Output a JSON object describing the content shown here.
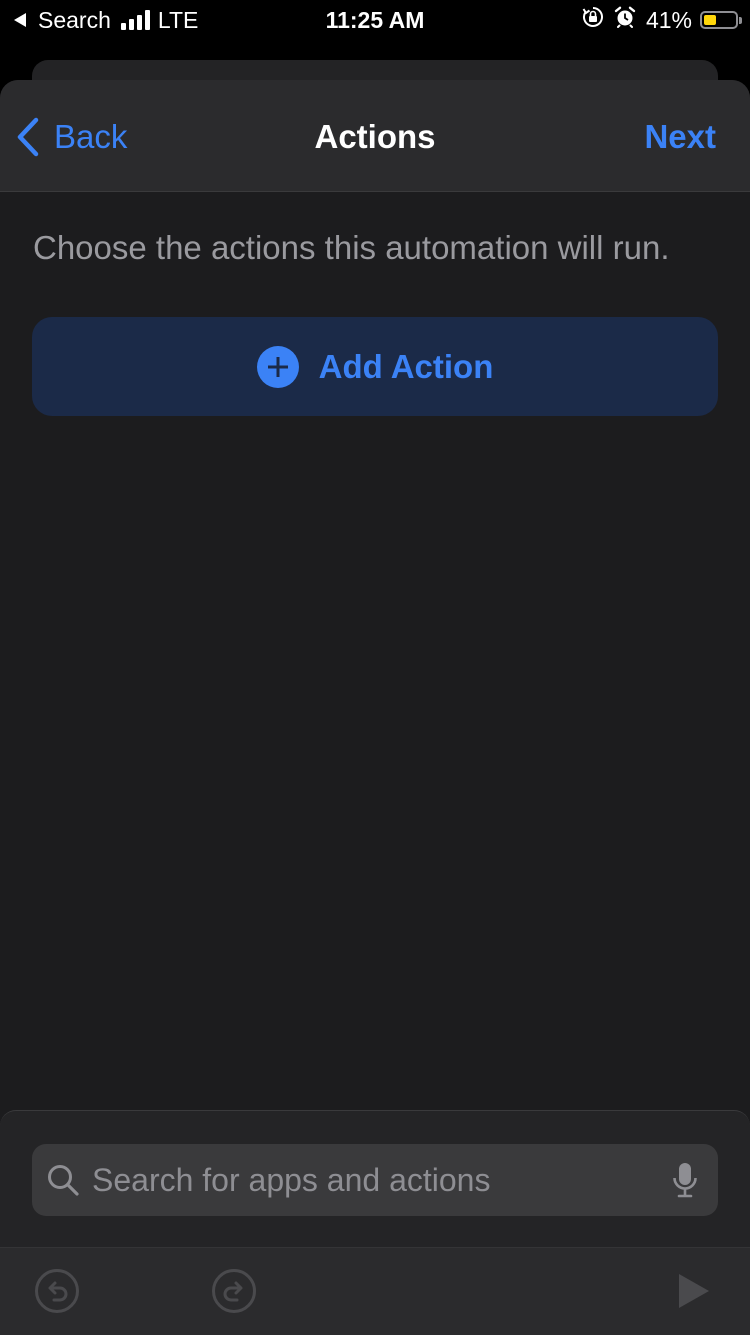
{
  "status_bar": {
    "back_app": "Search",
    "network": "LTE",
    "time": "11:25 AM",
    "battery_percent": "41%",
    "battery_level": 0.41,
    "battery_color": "#ffd60a",
    "icons": [
      "signal-bars-icon",
      "orientation-lock-icon",
      "alarm-icon",
      "battery-icon"
    ]
  },
  "nav": {
    "back_label": "Back",
    "title": "Actions",
    "next_label": "Next"
  },
  "main": {
    "description": "Choose the actions this automation will run.",
    "add_action_label": "Add Action"
  },
  "search": {
    "placeholder": "Search for apps and actions",
    "value": ""
  },
  "toolbar": {
    "icons": [
      "undo-icon",
      "redo-icon",
      "play-icon"
    ]
  },
  "colors": {
    "accent": "#3b82f6",
    "background": "#1c1c1e",
    "nav_background": "#2b2b2d",
    "button_background": "#1b2a48"
  }
}
